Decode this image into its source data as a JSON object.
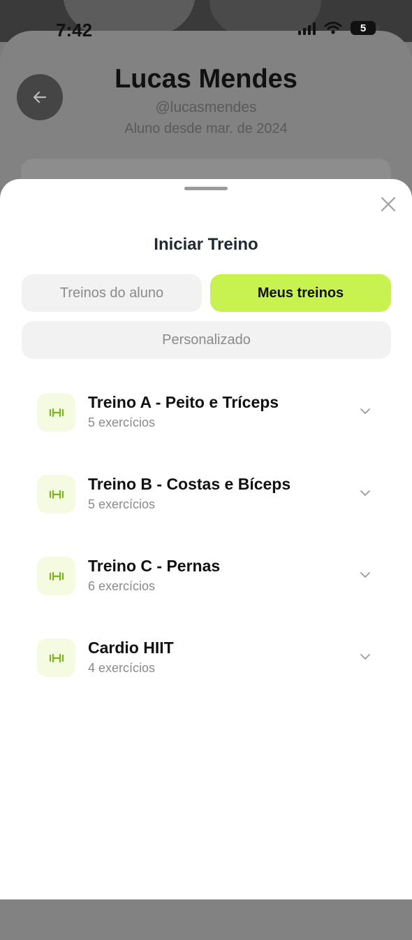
{
  "status_bar": {
    "time": "7:42",
    "battery": "5"
  },
  "profile": {
    "name": "Lucas Mendes",
    "handle": "@lucasmendes",
    "member_since": "Aluno desde mar. de 2024"
  },
  "sheet": {
    "title": "Iniciar Treino",
    "tabs": [
      {
        "label": "Treinos do aluno",
        "active": false
      },
      {
        "label": "Meus treinos",
        "active": true
      },
      {
        "label": "Personalizado",
        "active": false
      }
    ],
    "workouts": [
      {
        "title": "Treino A - Peito e Tríceps",
        "count": "5 exercícios"
      },
      {
        "title": "Treino B - Costas e Bíceps",
        "count": "5 exercícios"
      },
      {
        "title": "Treino C - Pernas",
        "count": "6 exercícios"
      },
      {
        "title": "Cardio HIIT",
        "count": "4 exercícios"
      }
    ]
  },
  "icons": {
    "back": "arrow-left-icon",
    "close": "close-icon",
    "workout": "dumbbell-icon",
    "expand": "chevron-down-icon"
  },
  "colors": {
    "accent": "#c8f250",
    "icon_bg": "#f4fbe0",
    "icon_fg": "#7cb518"
  }
}
